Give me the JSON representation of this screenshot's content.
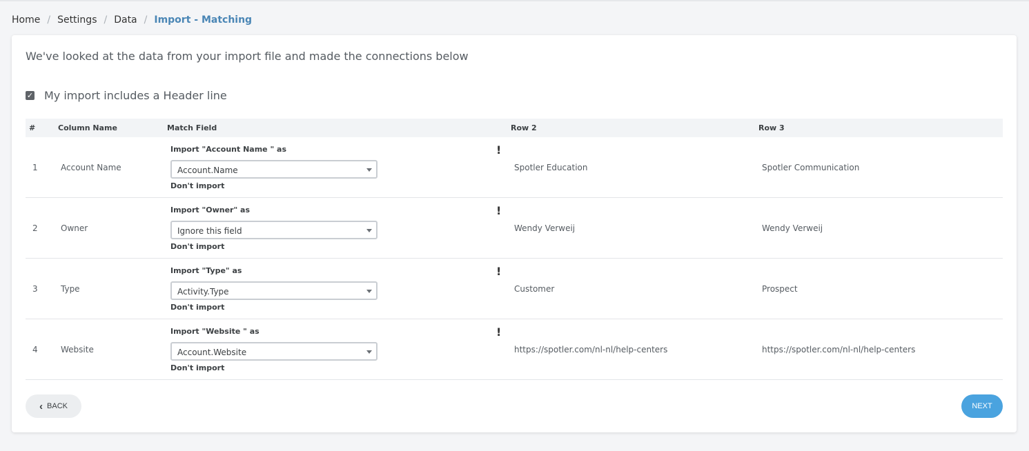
{
  "breadcrumb": {
    "items": [
      "Home",
      "Settings",
      "Data"
    ],
    "current": "Import - Matching",
    "separator": "/"
  },
  "intro_text": "We've looked at the data from your import file and made the connections below",
  "header_line": {
    "checked": true,
    "label": "My import includes a Header line"
  },
  "table": {
    "headers": {
      "num": "#",
      "column_name": "Column Name",
      "match_field": "Match Field",
      "row2": "Row 2",
      "row3": "Row 3"
    },
    "rows": [
      {
        "num": "1",
        "column_name": "Account Name",
        "match_label": "Import \"Account Name \" as",
        "selected": "Account.Name",
        "dont_import": "Don't import",
        "warn": "!",
        "row2": "Spotler Education",
        "row3": "Spotler Communication"
      },
      {
        "num": "2",
        "column_name": "Owner",
        "match_label": "Import \"Owner\" as",
        "selected": "Ignore this field",
        "dont_import": "Don't import",
        "warn": "!",
        "row2": "Wendy Verweij",
        "row3": "Wendy Verweij"
      },
      {
        "num": "3",
        "column_name": "Type",
        "match_label": "Import \"Type\" as",
        "selected": "Activity.Type",
        "dont_import": "Don't import",
        "warn": "!",
        "row2": "Customer",
        "row3": "Prospect"
      },
      {
        "num": "4",
        "column_name": "Website",
        "match_label": "Import \"Website \" as",
        "selected": "Account.Website",
        "dont_import": "Don't import",
        "warn": "!",
        "row2": "https://spotler.com/nl-nl/help-centers",
        "row3": "https://spotler.com/nl-nl/help-centers"
      }
    ]
  },
  "buttons": {
    "back": "BACK",
    "next": "NEXT"
  },
  "colors": {
    "accent": "#4aa3df",
    "breadcrumb_current": "#4a86b5"
  }
}
